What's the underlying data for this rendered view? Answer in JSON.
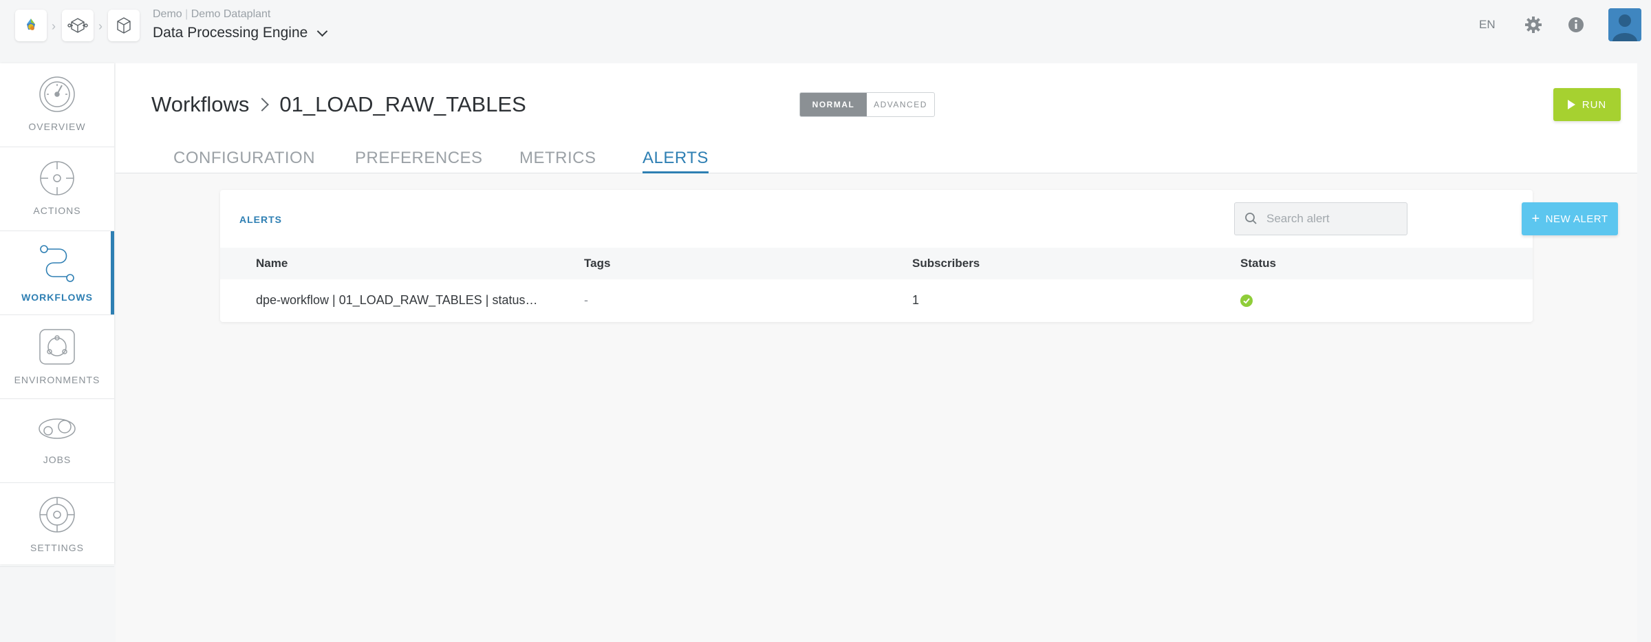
{
  "header": {
    "breadcrumb_icons": [
      "app-logo-icon",
      "cube-network-icon",
      "box-icon"
    ],
    "org": "Demo",
    "workspace": "Demo Dataplant",
    "project_title": "Data Processing Engine",
    "language": "EN",
    "settings_icon": "gear-icon",
    "info_icon": "info-icon"
  },
  "sidebar": {
    "items": [
      {
        "label": "OVERVIEW",
        "icon": "speedometer-icon",
        "active": false
      },
      {
        "label": "ACTIONS",
        "icon": "target-icon",
        "active": false
      },
      {
        "label": "WORKFLOWS",
        "icon": "workflow-icon",
        "active": true
      },
      {
        "label": "ENVIRONMENTS",
        "icon": "environment-icon",
        "active": false
      },
      {
        "label": "JOBS",
        "icon": "jobs-icon",
        "active": false
      },
      {
        "label": "SETTINGS",
        "icon": "settings-gear-icon",
        "active": false
      }
    ]
  },
  "page": {
    "section": "Workflows",
    "workflow": "01_LOAD_RAW_TABLES",
    "mode_normal": "NORMAL",
    "mode_advanced": "ADVANCED",
    "mode_selected": "NORMAL",
    "run_label": "RUN",
    "tabs": [
      "CONFIGURATION",
      "PREFERENCES",
      "METRICS",
      "ALERTS"
    ],
    "active_tab": "ALERTS"
  },
  "alerts": {
    "title": "ALERTS",
    "search_placeholder": "Search alert",
    "search_value": "",
    "new_alert_label": "NEW ALERT",
    "columns": [
      "Name",
      "Tags",
      "Subscribers",
      "Status"
    ],
    "rows": [
      {
        "name": "dpe-workflow | 01_LOAD_RAW_TABLES | status…",
        "tags": "-",
        "subscribers": "1",
        "status": "ok"
      }
    ]
  },
  "colors": {
    "accent": "#2e7fb3",
    "run": "#a6d130",
    "new_alert": "#5cc6ef",
    "status_ok": "#8fcd39"
  }
}
